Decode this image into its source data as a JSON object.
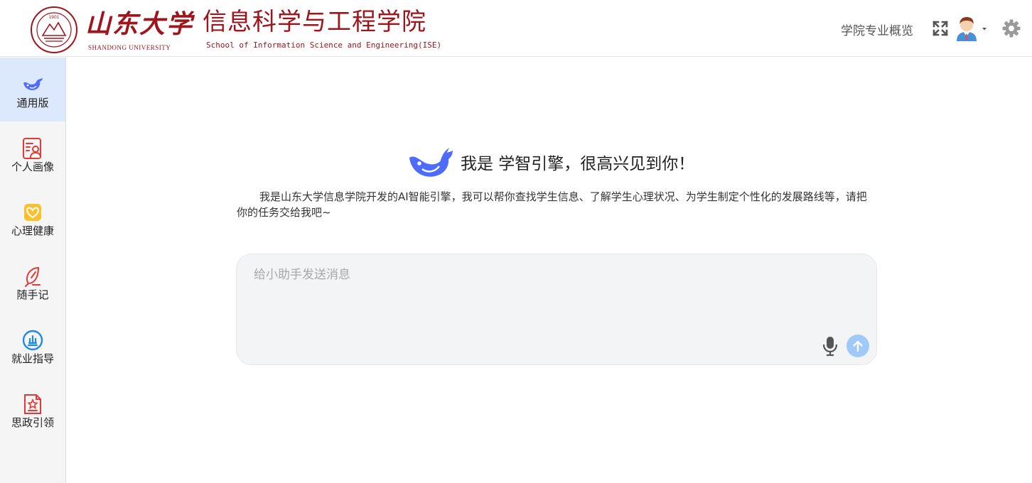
{
  "header": {
    "university_name_cn": "山东大学",
    "university_name_en": "SHANDONG UNIVERSITY",
    "seal_year": "1901",
    "school_name_cn": "信息科学与工程学院",
    "school_name_en": "School of Information Science and Engineering(ISE)",
    "nav_link": "学院专业概览",
    "brand_color": "#a0151c"
  },
  "sidebar": {
    "items": [
      {
        "label": "通用版",
        "icon": "whale-icon",
        "active": true
      },
      {
        "label": "个人画像",
        "icon": "profile-card-icon",
        "active": false
      },
      {
        "label": "心理健康",
        "icon": "heart-icon",
        "active": false
      },
      {
        "label": "随手记",
        "icon": "quill-icon",
        "active": false
      },
      {
        "label": "就业指导",
        "icon": "briefcase-icon",
        "active": false
      },
      {
        "label": "思政引领",
        "icon": "star-document-icon",
        "active": false
      }
    ],
    "active_color": "#dce8fb"
  },
  "main": {
    "greeting": "我是 学智引擎，很高兴见到你！",
    "intro": "我是山东大学信息学院开发的AI智能引擎，我可以帮你查找学生信息、了解学生心理状况、为学生制定个性化的发展路线等，请把你的任务交给我吧~",
    "input_placeholder": "给小助手发送消息",
    "accent_color": "#4d6bfe",
    "send_button_color": "#9ec9f8"
  }
}
